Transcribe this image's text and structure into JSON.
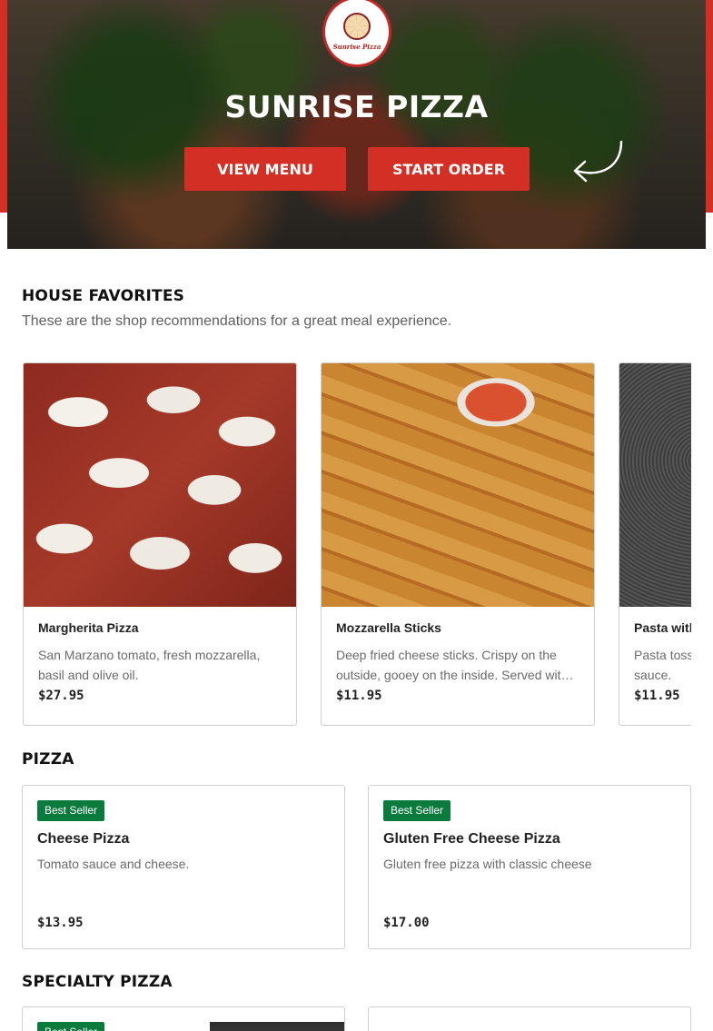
{
  "hero": {
    "title": "SUNRISE PIZZA",
    "logo_text": "Sunrise Pizza",
    "view_menu_label": "VIEW MENU",
    "start_order_label": "START ORDER"
  },
  "favorites": {
    "title": "HOUSE FAVORITES",
    "subtitle": "These are the shop recommendations for a great meal experience.",
    "items": [
      {
        "name": "Margherita Pizza",
        "description": "San Marzano tomato, fresh mozzarella, basil and olive oil.",
        "price": "$27.95"
      },
      {
        "name": "Mozzarella Sticks",
        "description": "Deep fried cheese sticks. Crispy on the outside, gooey on the inside. Served with marinara sauce.",
        "price": "$11.95"
      },
      {
        "name": "Pasta with Marinara Sauce",
        "description": "Pasta tossed in our homemade marinara sauce.",
        "price": "$11.95"
      }
    ]
  },
  "pizza": {
    "title": "PIZZA",
    "items": [
      {
        "badge": "Best Seller",
        "name": "Cheese Pizza",
        "description": "Tomato sauce and cheese.",
        "price": "$13.95"
      },
      {
        "badge": "Best Seller",
        "name": "Gluten Free Cheese Pizza",
        "description": "Gluten free pizza with classic cheese",
        "price": "$17.00"
      }
    ]
  },
  "specialty": {
    "title": "SPECIALTY PIZZA",
    "items": [
      {
        "badge": "Best Seller"
      },
      {}
    ]
  },
  "colors": {
    "accent": "#d32f25",
    "badge": "#0a7a3d"
  }
}
